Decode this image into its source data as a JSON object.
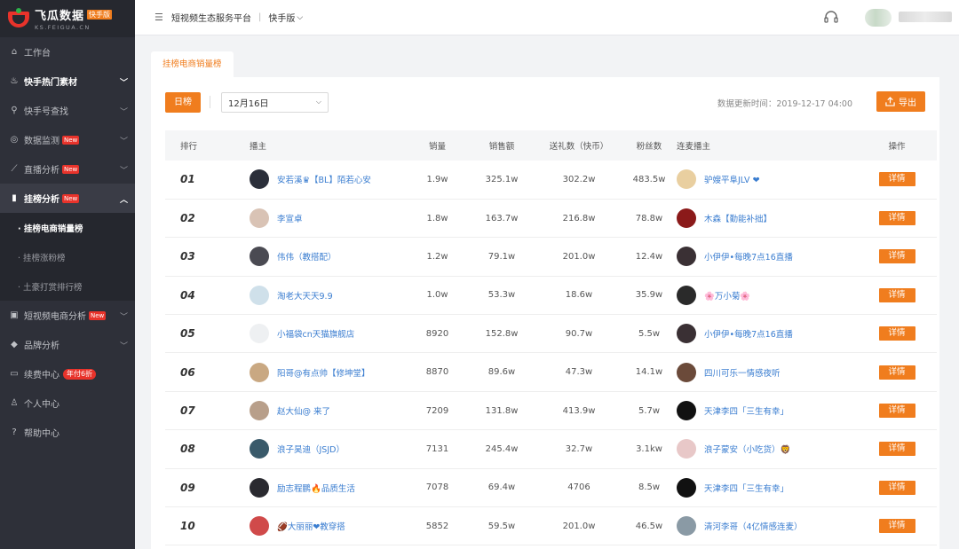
{
  "logo": {
    "name": "飞瓜数据",
    "badge": "快手版",
    "domain": "KS.FEIGUA.CN"
  },
  "sidebar": {
    "items": [
      {
        "label": "工作台",
        "icon": "home-icon",
        "chevron": false,
        "badge": ""
      },
      {
        "label": "快手热门素材",
        "icon": "flame-icon",
        "chevron": true,
        "badge": ""
      },
      {
        "label": "快手号查找",
        "icon": "search-icon",
        "chevron": true,
        "badge": ""
      },
      {
        "label": "数据监测",
        "icon": "monitor-icon",
        "chevron": true,
        "badge": "New"
      },
      {
        "label": "直播分析",
        "icon": "chart-line-icon",
        "chevron": true,
        "badge": "New"
      },
      {
        "label": "挂榜分析",
        "icon": "bar-chart-icon",
        "chevron": true,
        "badge": "New"
      },
      {
        "label": "短视频电商分析",
        "icon": "shop-icon",
        "chevron": true,
        "badge": "New"
      },
      {
        "label": "品牌分析",
        "icon": "diamond-icon",
        "chevron": true,
        "badge": ""
      },
      {
        "label": "续费中心",
        "icon": "card-icon",
        "chevron": false,
        "badge": "年付6折"
      },
      {
        "label": "个人中心",
        "icon": "user-icon",
        "chevron": false,
        "badge": ""
      },
      {
        "label": "帮助中心",
        "icon": "help-icon",
        "chevron": false,
        "badge": ""
      }
    ],
    "sub_items": [
      "· 挂榜电商销量榜",
      "· 挂榜涨粉榜",
      "· 土豪打赏排行榜"
    ]
  },
  "topbar": {
    "title": "短视频生态服务平台",
    "separator": "|",
    "platform": "快手版"
  },
  "tab": {
    "label": "挂榜电商销量榜"
  },
  "filters": {
    "day_button": "日榜",
    "date": "12月16日",
    "update_time": "数据更新时间：2019-12-17 04:00",
    "export_button": "导出"
  },
  "table": {
    "headers": [
      "排行",
      "播主",
      "销量",
      "销售额",
      "送礼数（快币）",
      "粉丝数",
      "连麦播主",
      "操作"
    ],
    "detail_label": "详情",
    "rows": [
      {
        "rank": "01",
        "host": "安若溪♛【BL】陌若心安",
        "sales": "1.9w",
        "revenue": "325.1w",
        "gifts": "302.2w",
        "fans": "483.5w",
        "partner": "驴嫂平阜JLV ❤",
        "host_color": "#2b2f3a",
        "partner_color": "#e9cfa0"
      },
      {
        "rank": "02",
        "host": "李宣卓",
        "sales": "1.8w",
        "revenue": "163.7w",
        "gifts": "216.8w",
        "fans": "78.8w",
        "partner": "木森【勤能补拙】",
        "host_color": "#d9c3b5",
        "partner_color": "#8b1a1a"
      },
      {
        "rank": "03",
        "host": "伟伟（教搭配）",
        "sales": "1.2w",
        "revenue": "79.1w",
        "gifts": "201.0w",
        "fans": "12.4w",
        "partner": "小伊伊•每晚7点16直播",
        "host_color": "#4a4a52",
        "partner_color": "#3a3034"
      },
      {
        "rank": "04",
        "host": "淘老大天天9.9",
        "sales": "1.0w",
        "revenue": "53.3w",
        "gifts": "18.6w",
        "fans": "35.9w",
        "partner": "🌸万小菊🌸",
        "host_color": "#cfe0ea",
        "partner_color": "#2a2a2a"
      },
      {
        "rank": "05",
        "host": "小福袋cn天猫旗舰店",
        "sales": "8920",
        "revenue": "152.8w",
        "gifts": "90.7w",
        "fans": "5.5w",
        "partner": "小伊伊•每晚7点16直播",
        "host_color": "#eef0f2",
        "partner_color": "#3a3034"
      },
      {
        "rank": "06",
        "host": "阳哥@有点帅【修坤堂】",
        "sales": "8870",
        "revenue": "89.6w",
        "gifts": "47.3w",
        "fans": "14.1w",
        "partner": "四川可乐一情感夜听",
        "host_color": "#c9a882",
        "partner_color": "#6b4a3a"
      },
      {
        "rank": "07",
        "host": "赵大仙@ 来了",
        "sales": "7209",
        "revenue": "131.8w",
        "gifts": "413.9w",
        "fans": "5.7w",
        "partner": "天津李四「三生有幸」",
        "host_color": "#b89f8a",
        "partner_color": "#111111"
      },
      {
        "rank": "08",
        "host": "浪子昊迪（JSJD）",
        "sales": "7131",
        "revenue": "245.4w",
        "gifts": "32.7w",
        "fans": "3.1kw",
        "partner": "浪子蒙安（小吃货）🦁",
        "host_color": "#3a5a6a",
        "partner_color": "#e8c8c8"
      },
      {
        "rank": "09",
        "host": "励志程鹏🔥品质生活",
        "sales": "7078",
        "revenue": "69.4w",
        "gifts": "4706",
        "fans": "8.5w",
        "partner": "天津李四「三生有幸」",
        "host_color": "#2a2a30",
        "partner_color": "#111111"
      },
      {
        "rank": "10",
        "host": "🏈大丽丽❤教穿搭",
        "sales": "5852",
        "revenue": "59.5w",
        "gifts": "201.0w",
        "fans": "46.5w",
        "partner": "清河李哥（4亿情感连麦）",
        "host_color": "#d04a4a",
        "partner_color": "#8a9aa5"
      }
    ]
  },
  "colors": {
    "accent": "#f07d1e",
    "sidebar_bg": "#2e3039",
    "link": "#3a7dd0"
  }
}
